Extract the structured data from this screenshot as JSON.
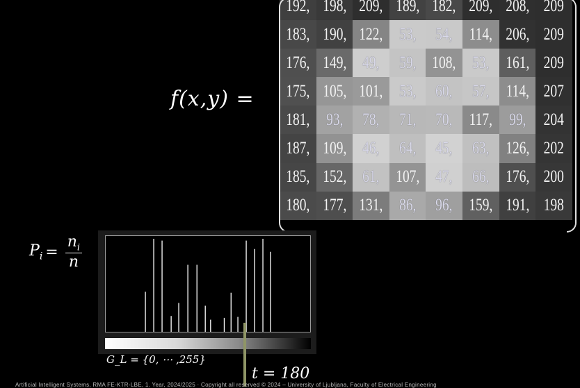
{
  "function_label": "f(x,y) =",
  "matrix": [
    [
      192,
      198,
      209,
      189,
      182,
      209,
      208,
      209
    ],
    [
      183,
      190,
      122,
      53,
      54,
      114,
      206,
      209
    ],
    [
      176,
      149,
      49,
      59,
      108,
      53,
      161,
      209
    ],
    [
      175,
      105,
      101,
      53,
      60,
      57,
      114,
      207
    ],
    [
      181,
      93,
      78,
      71,
      70,
      117,
      99,
      204
    ],
    [
      187,
      109,
      46,
      64,
      45,
      63,
      126,
      202
    ],
    [
      185,
      152,
      61,
      107,
      47,
      66,
      176,
      200
    ],
    [
      180,
      177,
      131,
      86,
      96,
      159,
      191,
      198
    ]
  ],
  "probability_formula": {
    "lhs": "P",
    "sub": "i",
    "equals": "=",
    "numerator": "n",
    "numerator_sub": "i",
    "denominator": "n"
  },
  "histogram_data": {
    "type": "bar",
    "x_range": [
      0,
      255
    ],
    "bars": [
      {
        "x": 45,
        "v": 0.43
      },
      {
        "x": 56,
        "v": 1.0
      },
      {
        "x": 67,
        "v": 0.98
      },
      {
        "x": 79,
        "v": 0.17
      },
      {
        "x": 89,
        "v": 0.31
      },
      {
        "x": 101,
        "v": 0.72
      },
      {
        "x": 113,
        "v": 0.72
      },
      {
        "x": 124,
        "v": 0.28
      },
      {
        "x": 131,
        "v": 0.13
      },
      {
        "x": 149,
        "v": 0.15
      },
      {
        "x": 158,
        "v": 0.42
      },
      {
        "x": 167,
        "v": 0.16
      },
      {
        "x": 178,
        "v": 0.98
      },
      {
        "x": 189,
        "v": 0.89
      },
      {
        "x": 200,
        "v": 1.0
      },
      {
        "x": 210,
        "v": 0.86
      }
    ]
  },
  "gray_levels_label": "G_L = {0, ⋯ ,255}",
  "threshold_label": "t = 180",
  "footer": "Artificial Intelligent Systems, RMA FE-KTR-LBE, 1. Year, 2024/2025  ·  Copyright all reserved © 2024 – University of Ljubljana, Faculty of Electrical Engineering"
}
